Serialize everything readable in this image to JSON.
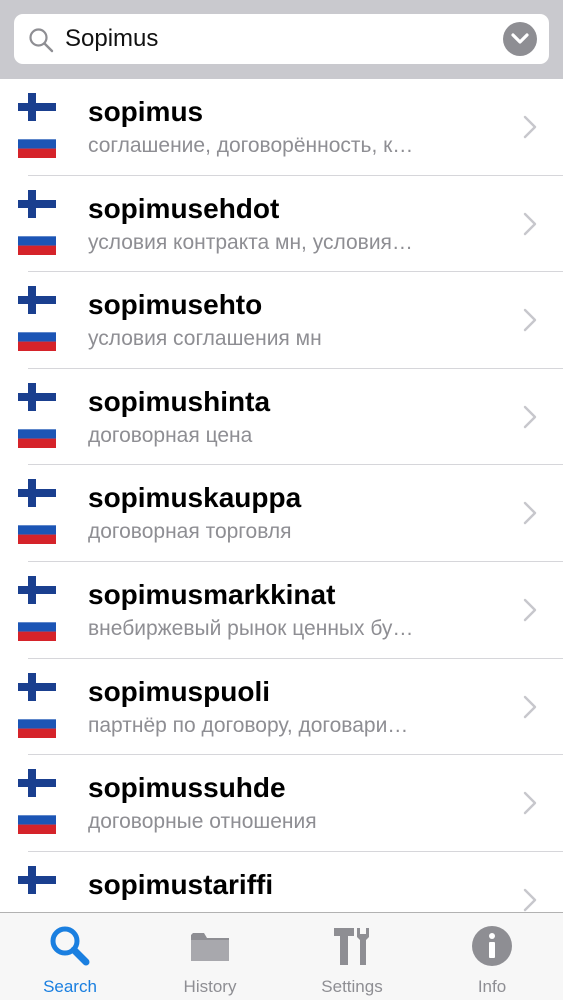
{
  "search": {
    "query": "Sopimus",
    "icon": "search-icon",
    "clear_icon": "chevron-down-icon"
  },
  "results": [
    {
      "word": "sopimus",
      "translation": "соглашение, договорённость, к…"
    },
    {
      "word": "sopimusehdot",
      "translation": "условия контракта  мн, условия…"
    },
    {
      "word": "sopimusehto",
      "translation": "условия соглашения  мн"
    },
    {
      "word": "sopimushinta",
      "translation": "договорная цена"
    },
    {
      "word": "sopimuskauppa",
      "translation": "договорная торговля"
    },
    {
      "word": "sopimusmarkkinat",
      "translation": "внебиржевый рынок ценных бу…"
    },
    {
      "word": "sopimuspuoli",
      "translation": "партнёр по договору, договари…"
    },
    {
      "word": "sopimussuhde",
      "translation": "договорные отношения"
    },
    {
      "word": "sopimustariffi",
      "translation": ""
    }
  ],
  "tabs": [
    {
      "label": "Search",
      "icon": "search-icon",
      "active": true
    },
    {
      "label": "History",
      "icon": "folder-icon",
      "active": false
    },
    {
      "label": "Settings",
      "icon": "tools-icon",
      "active": false
    },
    {
      "label": "Info",
      "icon": "info-icon",
      "active": false
    }
  ],
  "colors": {
    "accent": "#1a7fe0",
    "inactive": "#8e8e93",
    "search_bar_bg": "#c9c9ce"
  }
}
